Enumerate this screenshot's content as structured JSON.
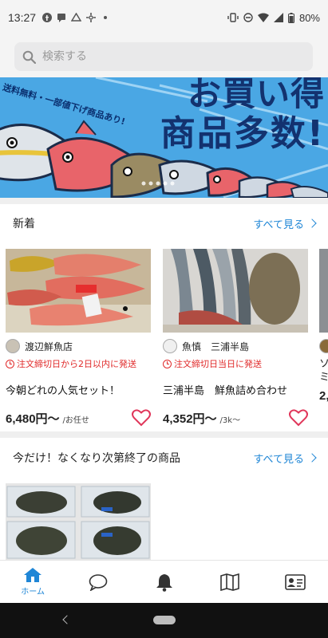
{
  "status_bar": {
    "time": "13:27",
    "battery": "80%"
  },
  "search": {
    "placeholder": "検索する"
  },
  "banner": {
    "tagline": "送料無料・一部値下げ商品あり!",
    "headline_line1": "お買い得",
    "headline_line2": "商品多数!",
    "colors": {
      "sky": "#4aa7e4",
      "ink": "#13326f"
    }
  },
  "sections": {
    "new": {
      "title": "新着",
      "see_all": "すべて見る"
    },
    "ending": {
      "title": "今だけ！なくなり次第終了の商品",
      "see_all": "すべて見る"
    }
  },
  "products": [
    {
      "shop": "渡辺鮮魚店",
      "shipping": "注文締切日から2日以内に発送",
      "name": "今朝どれの人気セット！",
      "price": "6,480円〜",
      "unit": "/お任せ"
    },
    {
      "shop": "魚慎　三浦半島",
      "shipping": "注文締切日当日に発送",
      "name": "三浦半島　鮮魚詰め合わせ",
      "price": "4,352円〜",
      "unit": "/3k〜"
    },
    {
      "shop": "",
      "shipping": "",
      "name": "ソ",
      "name2": "ミ",
      "price": "2,"
    }
  ],
  "bottom_nav": {
    "home_label": "ホーム",
    "items": [
      "home-icon",
      "chat-icon",
      "bell-icon",
      "map-icon",
      "profile-card-icon"
    ],
    "active_color": "#1f86d6"
  }
}
